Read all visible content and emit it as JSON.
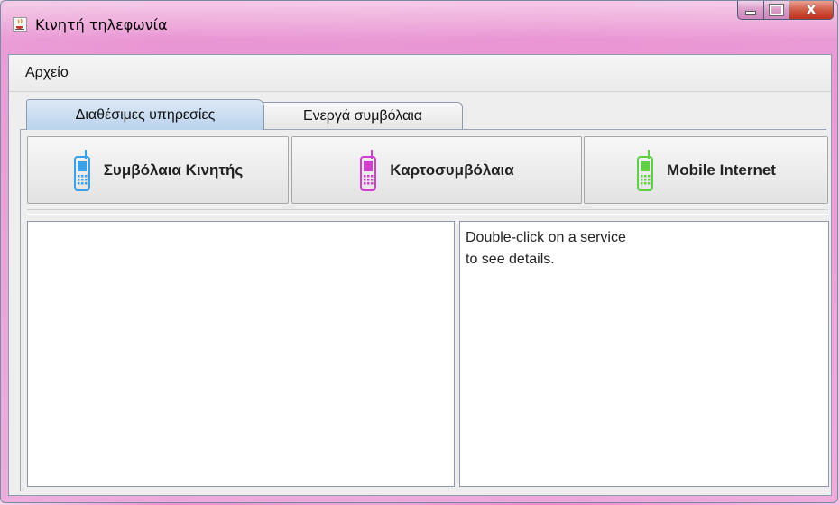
{
  "window": {
    "title": "Κινητή τηλεφωνία",
    "app_icon": "java-cup-icon",
    "controls": {
      "minimize_icon": "minimize-icon",
      "maximize_icon": "maximize-icon",
      "close_icon": "close-icon",
      "close_glyph": "X"
    }
  },
  "menubar": {
    "items": [
      {
        "label": "Αρχείο"
      }
    ]
  },
  "tabs": [
    {
      "label": "Διαθέσιμες υπηρεσίες",
      "selected": true
    },
    {
      "label": "Ενεργά συμβόλαια",
      "selected": false
    }
  ],
  "services": [
    {
      "label": "Συμβόλαια Κινητής",
      "icon": "mobile-phone-icon",
      "color": "#3aa0e8"
    },
    {
      "label": "Καρτοσυμβόλαια",
      "icon": "mobile-phone-icon",
      "color": "#d23fd0"
    },
    {
      "label": "Mobile Internet",
      "icon": "mobile-phone-icon",
      "color": "#5ed044"
    }
  ],
  "details": {
    "lines": [
      "Double-click on a service",
      "to see details."
    ]
  },
  "colors": {
    "tab_selected": "#b9d2ec",
    "desktop_accent": "#ec8fd0"
  }
}
